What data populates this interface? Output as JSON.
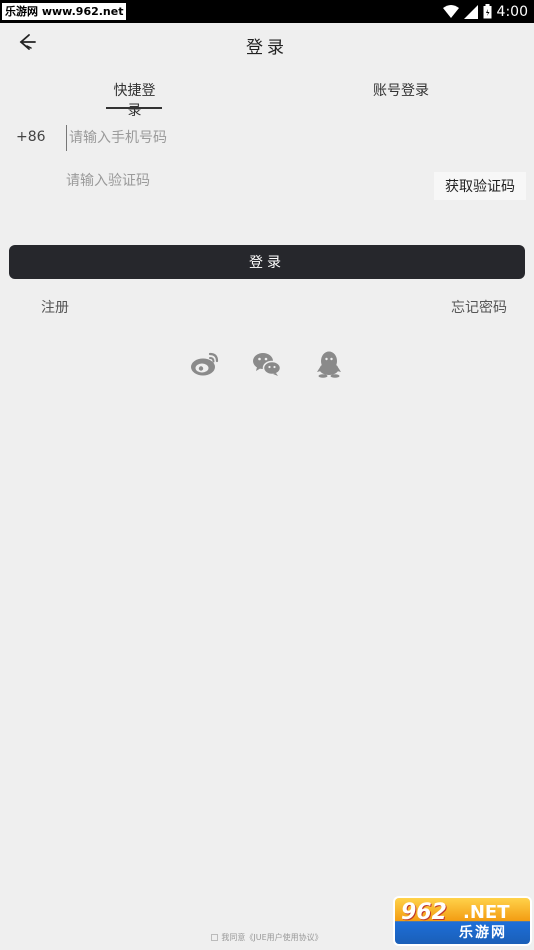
{
  "status_bar": {
    "watermark": "乐游网 www.962.net",
    "time": "4:00"
  },
  "header": {
    "back_icon": "back-arrow-icon",
    "title": "登录"
  },
  "tabs": [
    {
      "label": "快捷登录",
      "active": true
    },
    {
      "label": "账号登录",
      "active": false
    }
  ],
  "form": {
    "country_code": "+86",
    "phone_placeholder": "请输入手机号码",
    "phone_value": "",
    "code_placeholder": "请输入验证码",
    "code_value": "",
    "get_code_label": "获取验证码",
    "login_label": "登录"
  },
  "links": {
    "register": "注册",
    "forgot_password": "忘记密码"
  },
  "social": [
    {
      "icon": "weibo-icon"
    },
    {
      "icon": "wechat-icon"
    },
    {
      "icon": "qq-icon"
    }
  ],
  "agreement": {
    "text": "我同意《JUE用户使用协议》"
  },
  "bottom_watermark": {
    "number": "962",
    "net": ".NET",
    "cn": "乐游网"
  },
  "colors": {
    "background": "#efefef",
    "primary_button": "#26272c",
    "icon_gray": "#888888"
  }
}
